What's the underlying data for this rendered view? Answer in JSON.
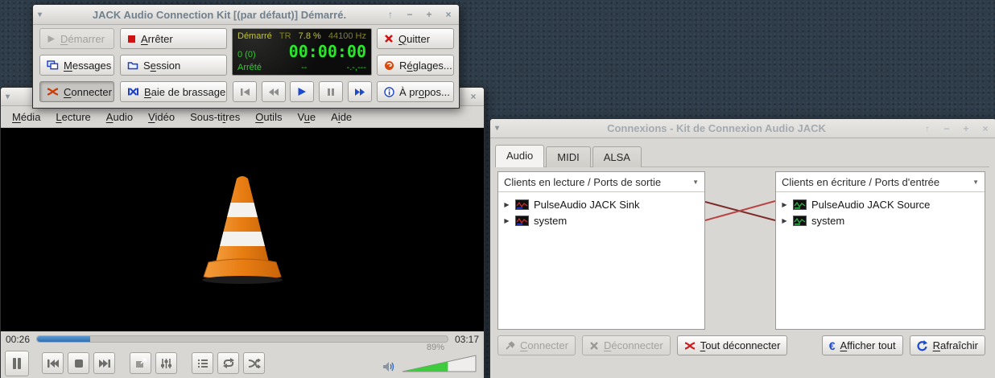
{
  "glyphs": {
    "dropdown": "▾",
    "shade": "↑",
    "min": "−",
    "max": "+",
    "close": "×",
    "sort": "▼",
    "expand": "▶",
    "euro": "€"
  },
  "jack": {
    "title": "JACK Audio Connection Kit [(par défaut)] Démarré.",
    "buttons": {
      "start": {
        "pre": "",
        "key": "D",
        "post": "émarrer"
      },
      "stop": {
        "pre": "",
        "key": "A",
        "post": "rrêter"
      },
      "messages": {
        "pre": "",
        "key": "M",
        "post": "essages"
      },
      "session": {
        "pre": "S",
        "key": "e",
        "post": "ssion"
      },
      "connect": {
        "pre": "",
        "key": "C",
        "post": "onnecter"
      },
      "patchbay": {
        "pre": "",
        "key": "B",
        "post": "aie de brassage"
      },
      "quit": {
        "pre": "",
        "key": "Q",
        "post": "uitter"
      },
      "settings": {
        "pre": "R",
        "key": "é",
        "post": "glages..."
      },
      "about": {
        "pre": "À pr",
        "key": "o",
        "post": "pos..."
      }
    },
    "display": {
      "status": "Démarré",
      "mode": "TR",
      "dsp": "7.8 %",
      "rate": "44100 Hz",
      "xruns": "0 (0)",
      "clock": "00:00:00",
      "transport": "Arrêté",
      "bbt": "--",
      "ttime": "-.-,---"
    },
    "colors": {
      "status_yellow": "#c2c23a",
      "dim_yellow": "#83831f",
      "green": "#2fca2f",
      "clock_green": "#2be52b"
    }
  },
  "vlc": {
    "menu": [
      {
        "pre": "",
        "key": "M",
        "post": "édia"
      },
      {
        "pre": "",
        "key": "L",
        "post": "ecture"
      },
      {
        "pre": "",
        "key": "A",
        "post": "udio"
      },
      {
        "pre": "",
        "key": "V",
        "post": "idéo"
      },
      {
        "pre": "Sous-ti",
        "key": "t",
        "post": "res"
      },
      {
        "pre": "",
        "key": "O",
        "post": "utils"
      },
      {
        "pre": "V",
        "key": "u",
        "post": "e"
      },
      {
        "pre": "A",
        "key": "i",
        "post": "de"
      }
    ],
    "elapsed": "00:26",
    "total": "03:17",
    "progress_pct": 13,
    "volume_label": "89%",
    "volume_fill_pct": 62,
    "accent_blue": "#3a7abf",
    "volume_green": "#3ecb3e"
  },
  "conn": {
    "title": "Connexions - Kit de Connexion Audio JACK",
    "tabs": [
      "Audio",
      "MIDI",
      "ALSA"
    ],
    "left_panel": {
      "header": "Clients en lecture / Ports de sortie",
      "items": [
        "PulseAudio JACK Sink",
        "system"
      ]
    },
    "right_panel": {
      "header": "Clients en écriture / Ports d'entrée",
      "items": [
        "PulseAudio JACK Source",
        "system"
      ]
    },
    "buttons": {
      "connect": {
        "pre": "",
        "key": "C",
        "post": "onnecter"
      },
      "disconnect": {
        "pre": "",
        "key": "D",
        "post": "éconnecter"
      },
      "disconnect_all": {
        "pre": "",
        "key": "T",
        "post": "out déconnecter"
      },
      "show_all": {
        "pre": "",
        "key": "A",
        "post": "fficher tout"
      },
      "refresh": {
        "pre": "",
        "key": "R",
        "post": "afraîchir"
      }
    },
    "line_color": "#a03434"
  }
}
